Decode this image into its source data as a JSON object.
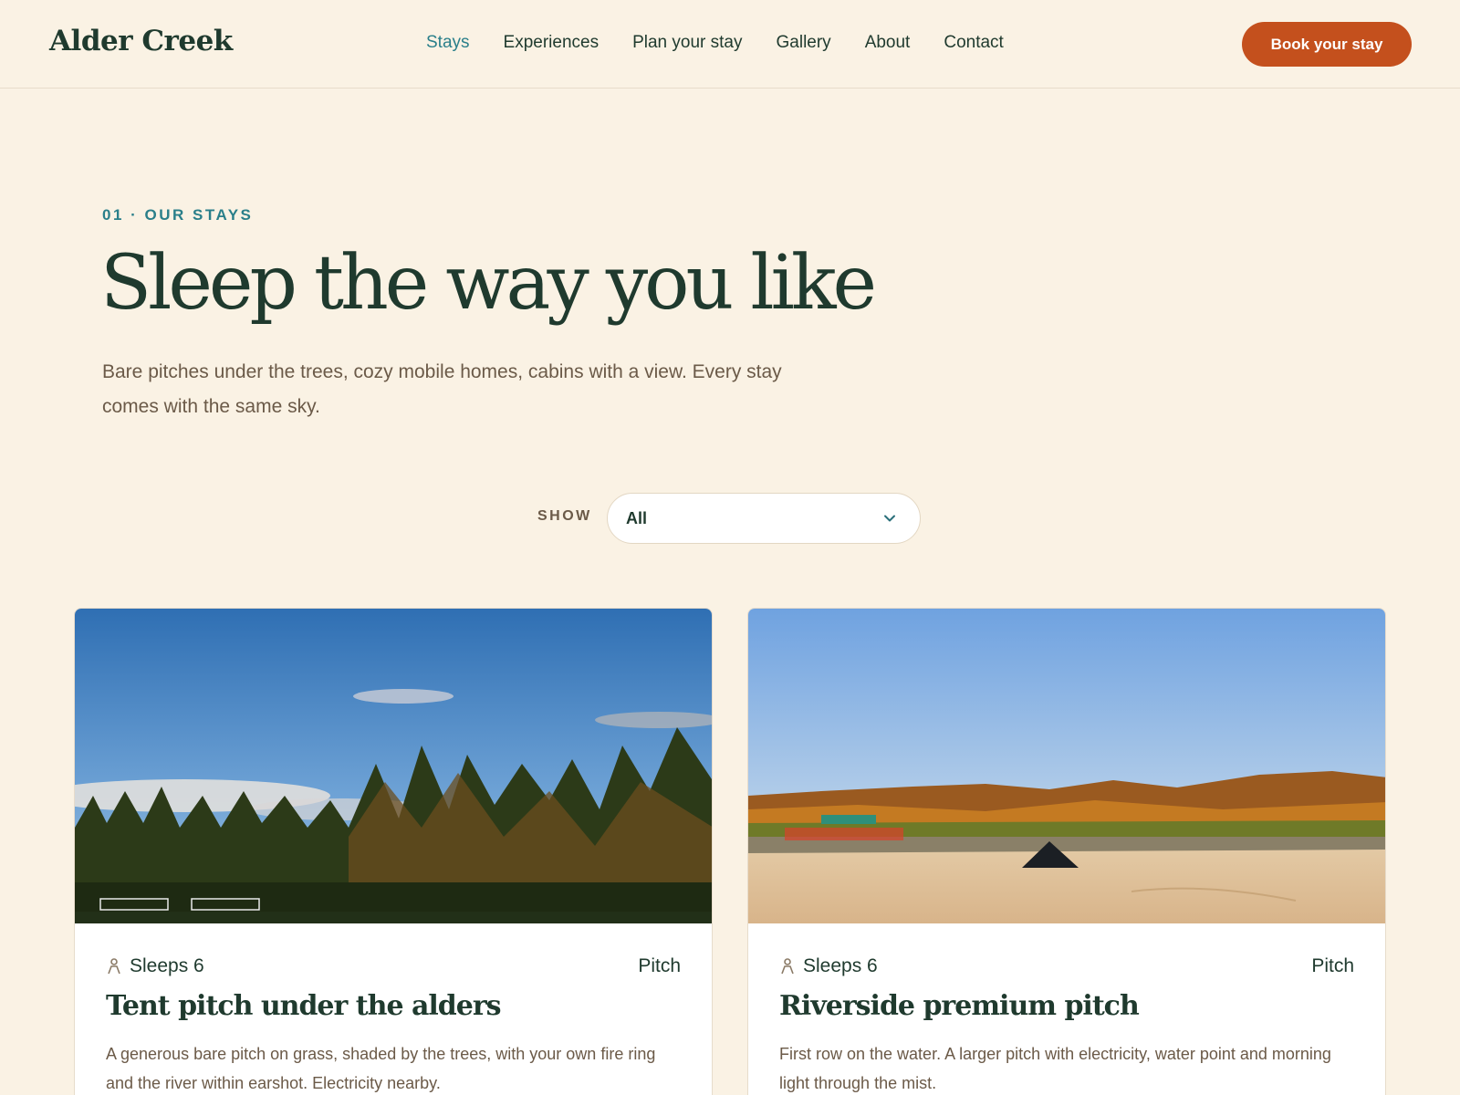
{
  "header": {
    "logo": "Alder Creek",
    "nav": [
      "Stays",
      "Experiences",
      "Plan your stay",
      "Gallery",
      "About",
      "Contact"
    ],
    "active_nav": "Stays",
    "cta": "Book your stay"
  },
  "hero": {
    "eyebrow": "01 · OUR STAYS",
    "title": "Sleep the way you like",
    "subtitle": "Bare pitches under the trees, cozy mobile homes, cabins with a view. Every stay comes with the same sky."
  },
  "filter": {
    "label": "SHOW",
    "selected": "All"
  },
  "cards": [
    {
      "sleeps": "Sleeps 6",
      "type": "Pitch",
      "title": "Tent pitch under the alders",
      "description": "A generous bare pitch on grass, shaded by the trees, with your own fire ring and the river within earshot. Electricity nearby."
    },
    {
      "sleeps": "Sleeps 6",
      "type": "Pitch",
      "title": "Riverside premium pitch",
      "description": "First row on the water. A larger pitch with electricity, water point and morning light through the mist."
    }
  ],
  "colors": {
    "background": "#faf2e4",
    "accent": "#c4501d",
    "teal": "#2a7f8a",
    "ink": "#1f3a2e"
  }
}
